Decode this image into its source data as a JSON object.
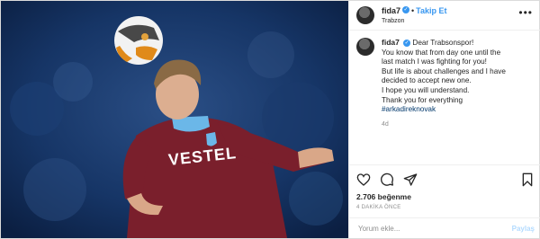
{
  "header": {
    "username": "fida7",
    "follow_label": "Takip Et",
    "location": "Trabzon"
  },
  "caption": {
    "username": "fida7",
    "lines": [
      "Dear Trabsonspor!",
      "You know that from day one until the",
      "last match I was fighting for you!",
      "But life is about challenges and I have",
      "decided to accept new one.",
      "I hope you will understand.",
      "Thank you for everything"
    ],
    "hashtag": "#arkadireknovak",
    "age": "4d"
  },
  "likes": {
    "count": "2.706",
    "label": "beğenme"
  },
  "date": "4 DAKİKA ÖNCE",
  "comment": {
    "placeholder": "Yorum ekle...",
    "share_label": "Paylaş"
  },
  "photo": {
    "jersey_text": "VESTEL"
  },
  "icons": [
    "more-icon",
    "heart-icon",
    "comment-icon",
    "share-icon",
    "bookmark-icon",
    "verified-badge-icon"
  ]
}
